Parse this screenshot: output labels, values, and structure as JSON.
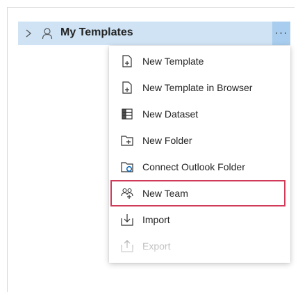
{
  "tree": {
    "header_label": "My Templates",
    "more_label": "···"
  },
  "menu": {
    "items": [
      {
        "label": "New Template",
        "icon": "new-template-icon"
      },
      {
        "label": "New Template in Browser",
        "icon": "new-template-browser-icon"
      },
      {
        "label": "New Dataset",
        "icon": "dataset-icon"
      },
      {
        "label": "New Folder",
        "icon": "new-folder-icon"
      },
      {
        "label": "Connect Outlook Folder",
        "icon": "outlook-folder-icon"
      },
      {
        "label": "New Team",
        "icon": "team-icon"
      },
      {
        "label": "Import",
        "icon": "import-icon"
      },
      {
        "label": "Export",
        "icon": "export-icon"
      }
    ],
    "highlighted_item": "New Team"
  },
  "colors": {
    "header_bg": "#cfe3f5",
    "more_button_bg": "#a8cdee",
    "highlight_border": "#d13b5a",
    "outlook_blue": "#0f6cbd"
  }
}
